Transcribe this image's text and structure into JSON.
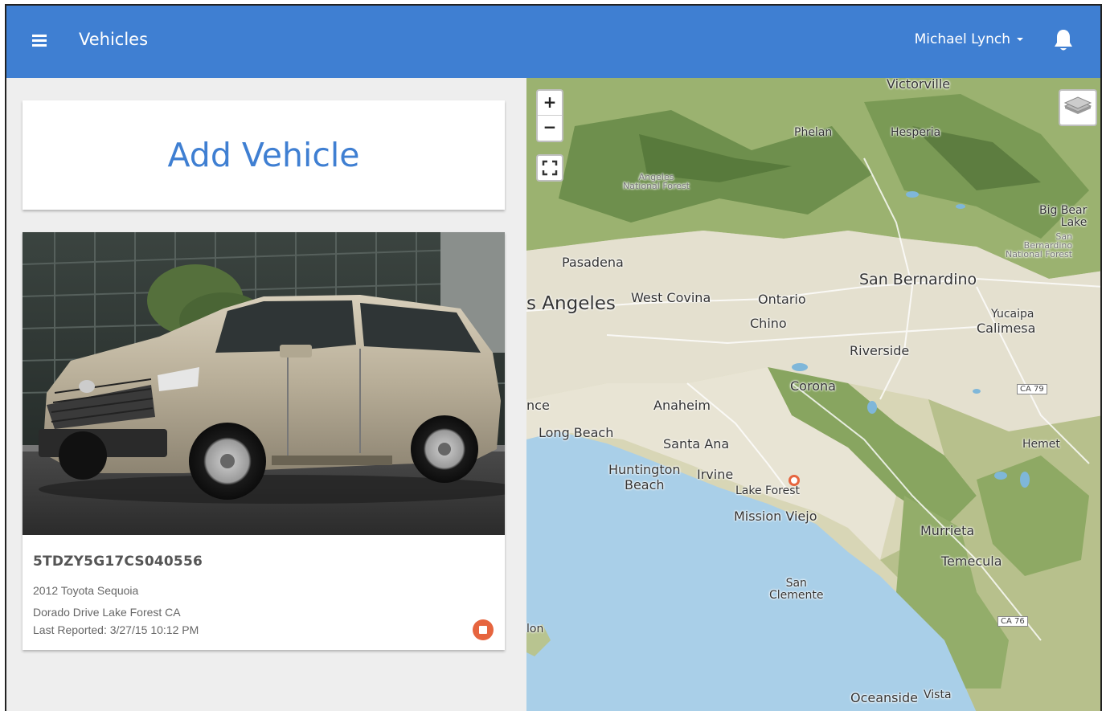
{
  "header": {
    "title": "Vehicles",
    "user_name": "Michael Lynch",
    "accent_color": "#3f7fd2"
  },
  "left_panel": {
    "add_vehicle_label": "Add Vehicle",
    "vehicle": {
      "vin": "5TDZY5G17CS040556",
      "model": "2012 Toyota Sequoia",
      "address": "Dorado Drive Lake Forest CA",
      "last_reported": "Last Reported: 3/27/15 10:12 PM",
      "status_icon": "stop-icon",
      "status_color": "#e6653f"
    }
  },
  "map": {
    "zoom_in": "+",
    "zoom_out": "−",
    "labels": {
      "victorville": "Victorville",
      "phelan": "Phelan",
      "hesperia": "Hesperia",
      "angeles_nf": "Angeles\nNational Forest",
      "big_bear": "Big Bear\nLake",
      "sb_nf": "San\nBernardino\nNational Forest",
      "pasadena": "Pasadena",
      "san_bernardino": "San Bernardino",
      "los_angeles": "s Angeles",
      "west_covina": "West Covina",
      "ontario": "Ontario",
      "chino": "Chino",
      "yucaipa": "Yucaipa",
      "calimesa": "Calimesa",
      "riverside": "Riverside",
      "corona": "Corona",
      "ca79": "CA 79",
      "torrance": "nce",
      "anaheim": "Anaheim",
      "long_beach": "Long Beach",
      "santa_ana": "Santa Ana",
      "hemet": "Hemet",
      "huntington": "Huntington\nBeach",
      "irvine": "Irvine",
      "lake_forest": "Lake Forest",
      "mission_viejo": "Mission Viejo",
      "murrieta": "Murrieta",
      "temecula": "Temecula",
      "san_clemente": "San\nClemente",
      "ca76": "CA 76",
      "avalon": "lon",
      "oceanside": "Oceanside",
      "vista": "Vista"
    }
  }
}
